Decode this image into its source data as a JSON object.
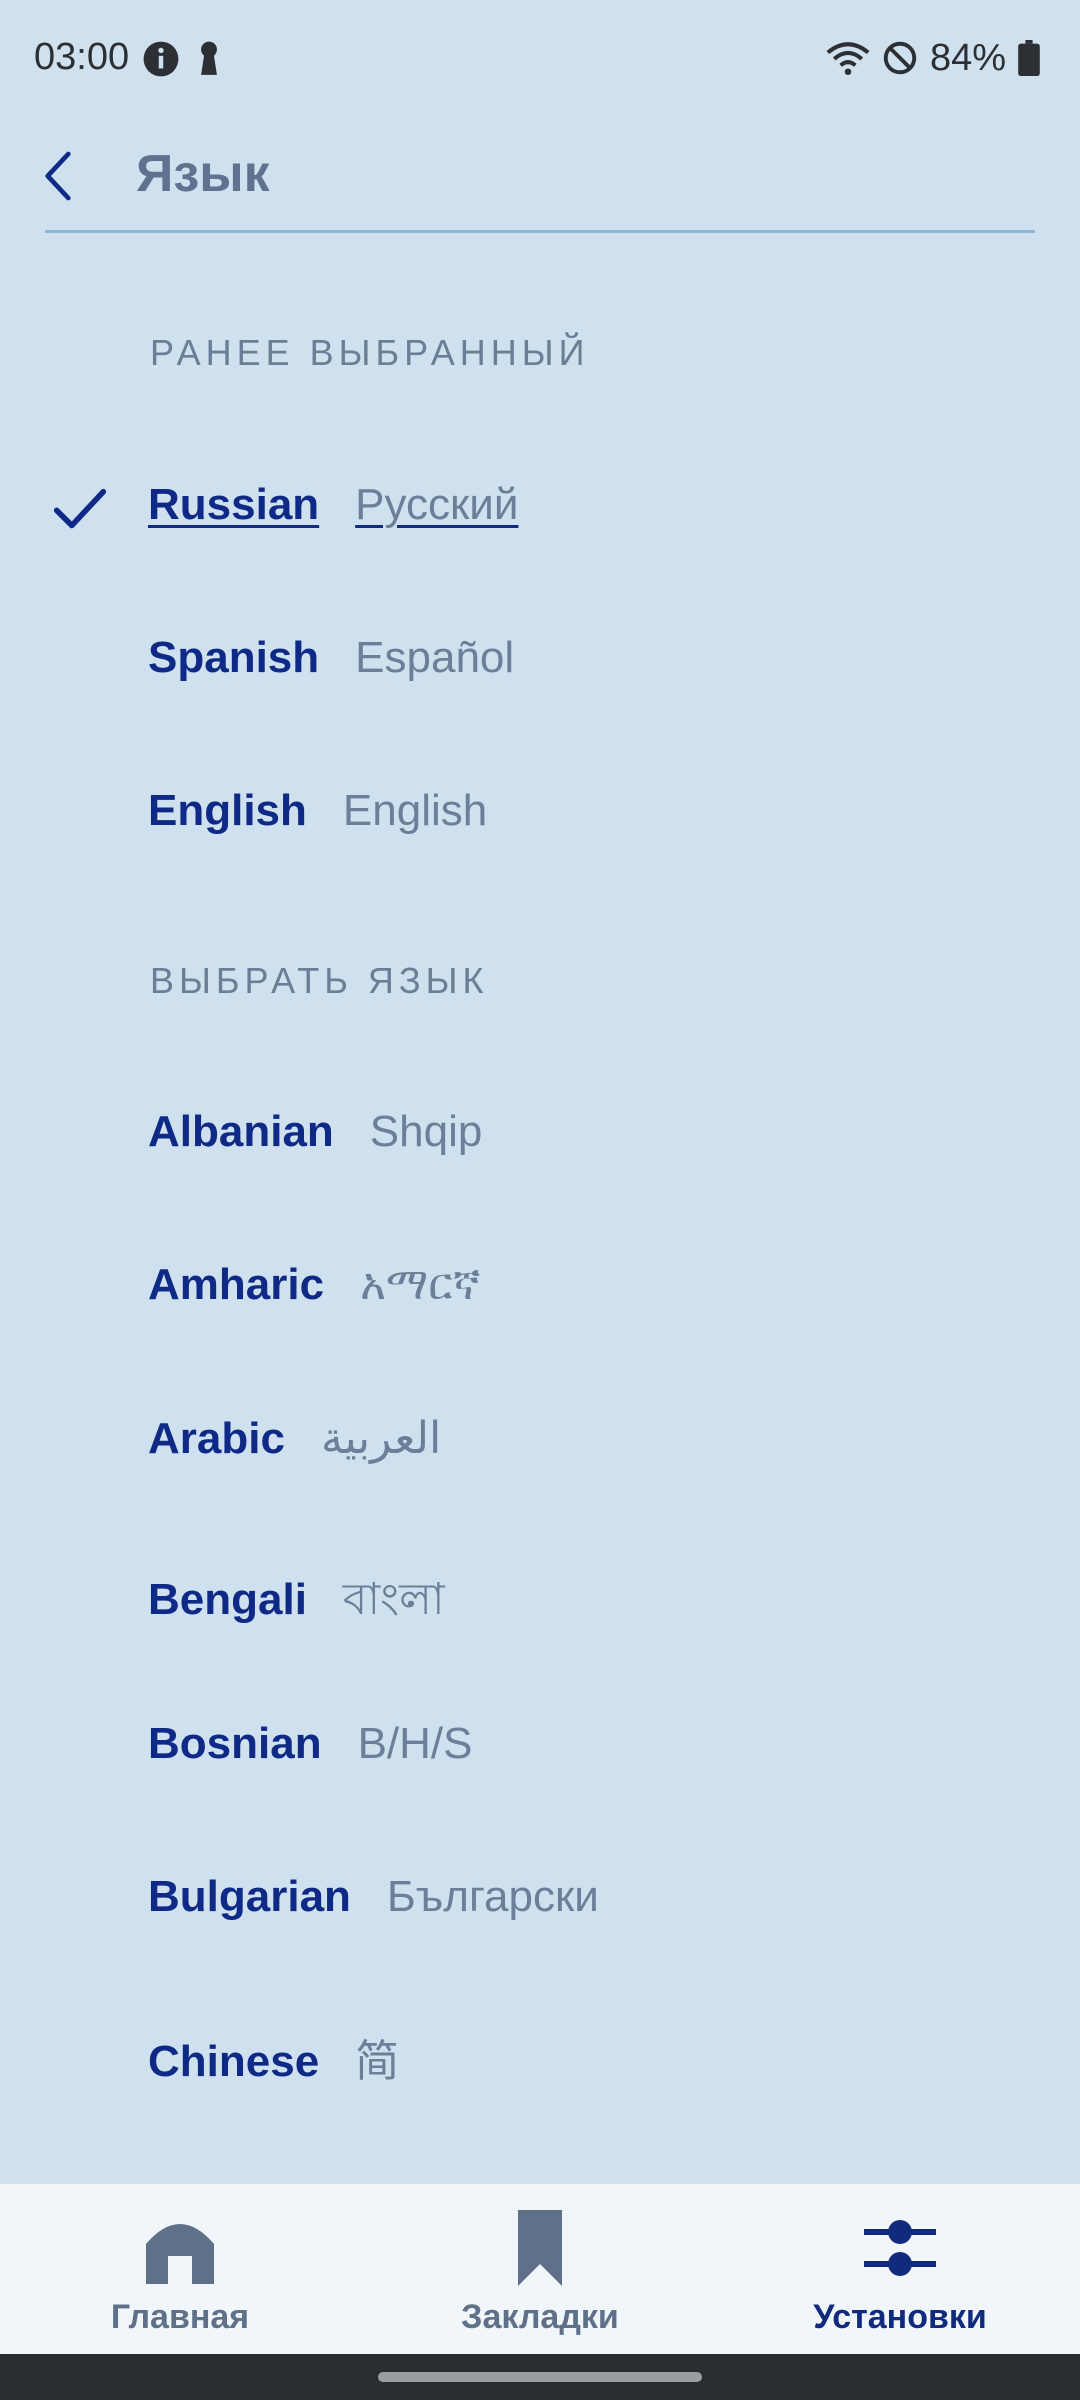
{
  "status_bar": {
    "time": "03:00",
    "battery": "84%"
  },
  "app_bar": {
    "title": "Язык",
    "back_icon": "chevron-left-icon"
  },
  "sections": {
    "previous_header": "РАНЕЕ ВЫБРАННЫЙ",
    "choose_header": "ВЫБРАТЬ ЯЗЫК"
  },
  "previous_languages": [
    {
      "name": "Russian",
      "native": "Русский",
      "selected": true
    },
    {
      "name": "Spanish",
      "native": "Español",
      "selected": false
    },
    {
      "name": "English",
      "native": "English",
      "selected": false
    }
  ],
  "languages": [
    {
      "name": "Albanian",
      "native": "Shqip"
    },
    {
      "name": "Amharic",
      "native": "አማርኛ"
    },
    {
      "name": "Arabic",
      "native": "العربية"
    },
    {
      "name": "Bengali",
      "native": "বাংলা"
    },
    {
      "name": "Bosnian",
      "native": "B/H/S"
    },
    {
      "name": "Bulgarian",
      "native": "Български"
    },
    {
      "name": "Chinese",
      "native": "简"
    }
  ],
  "bottom_nav": {
    "home": "Главная",
    "bookmarks": "Закладки",
    "settings": "Установки",
    "active": "settings"
  },
  "colors": {
    "background": "#cfe1ee",
    "accent": "#0f2a86",
    "muted": "#6b7f98"
  }
}
